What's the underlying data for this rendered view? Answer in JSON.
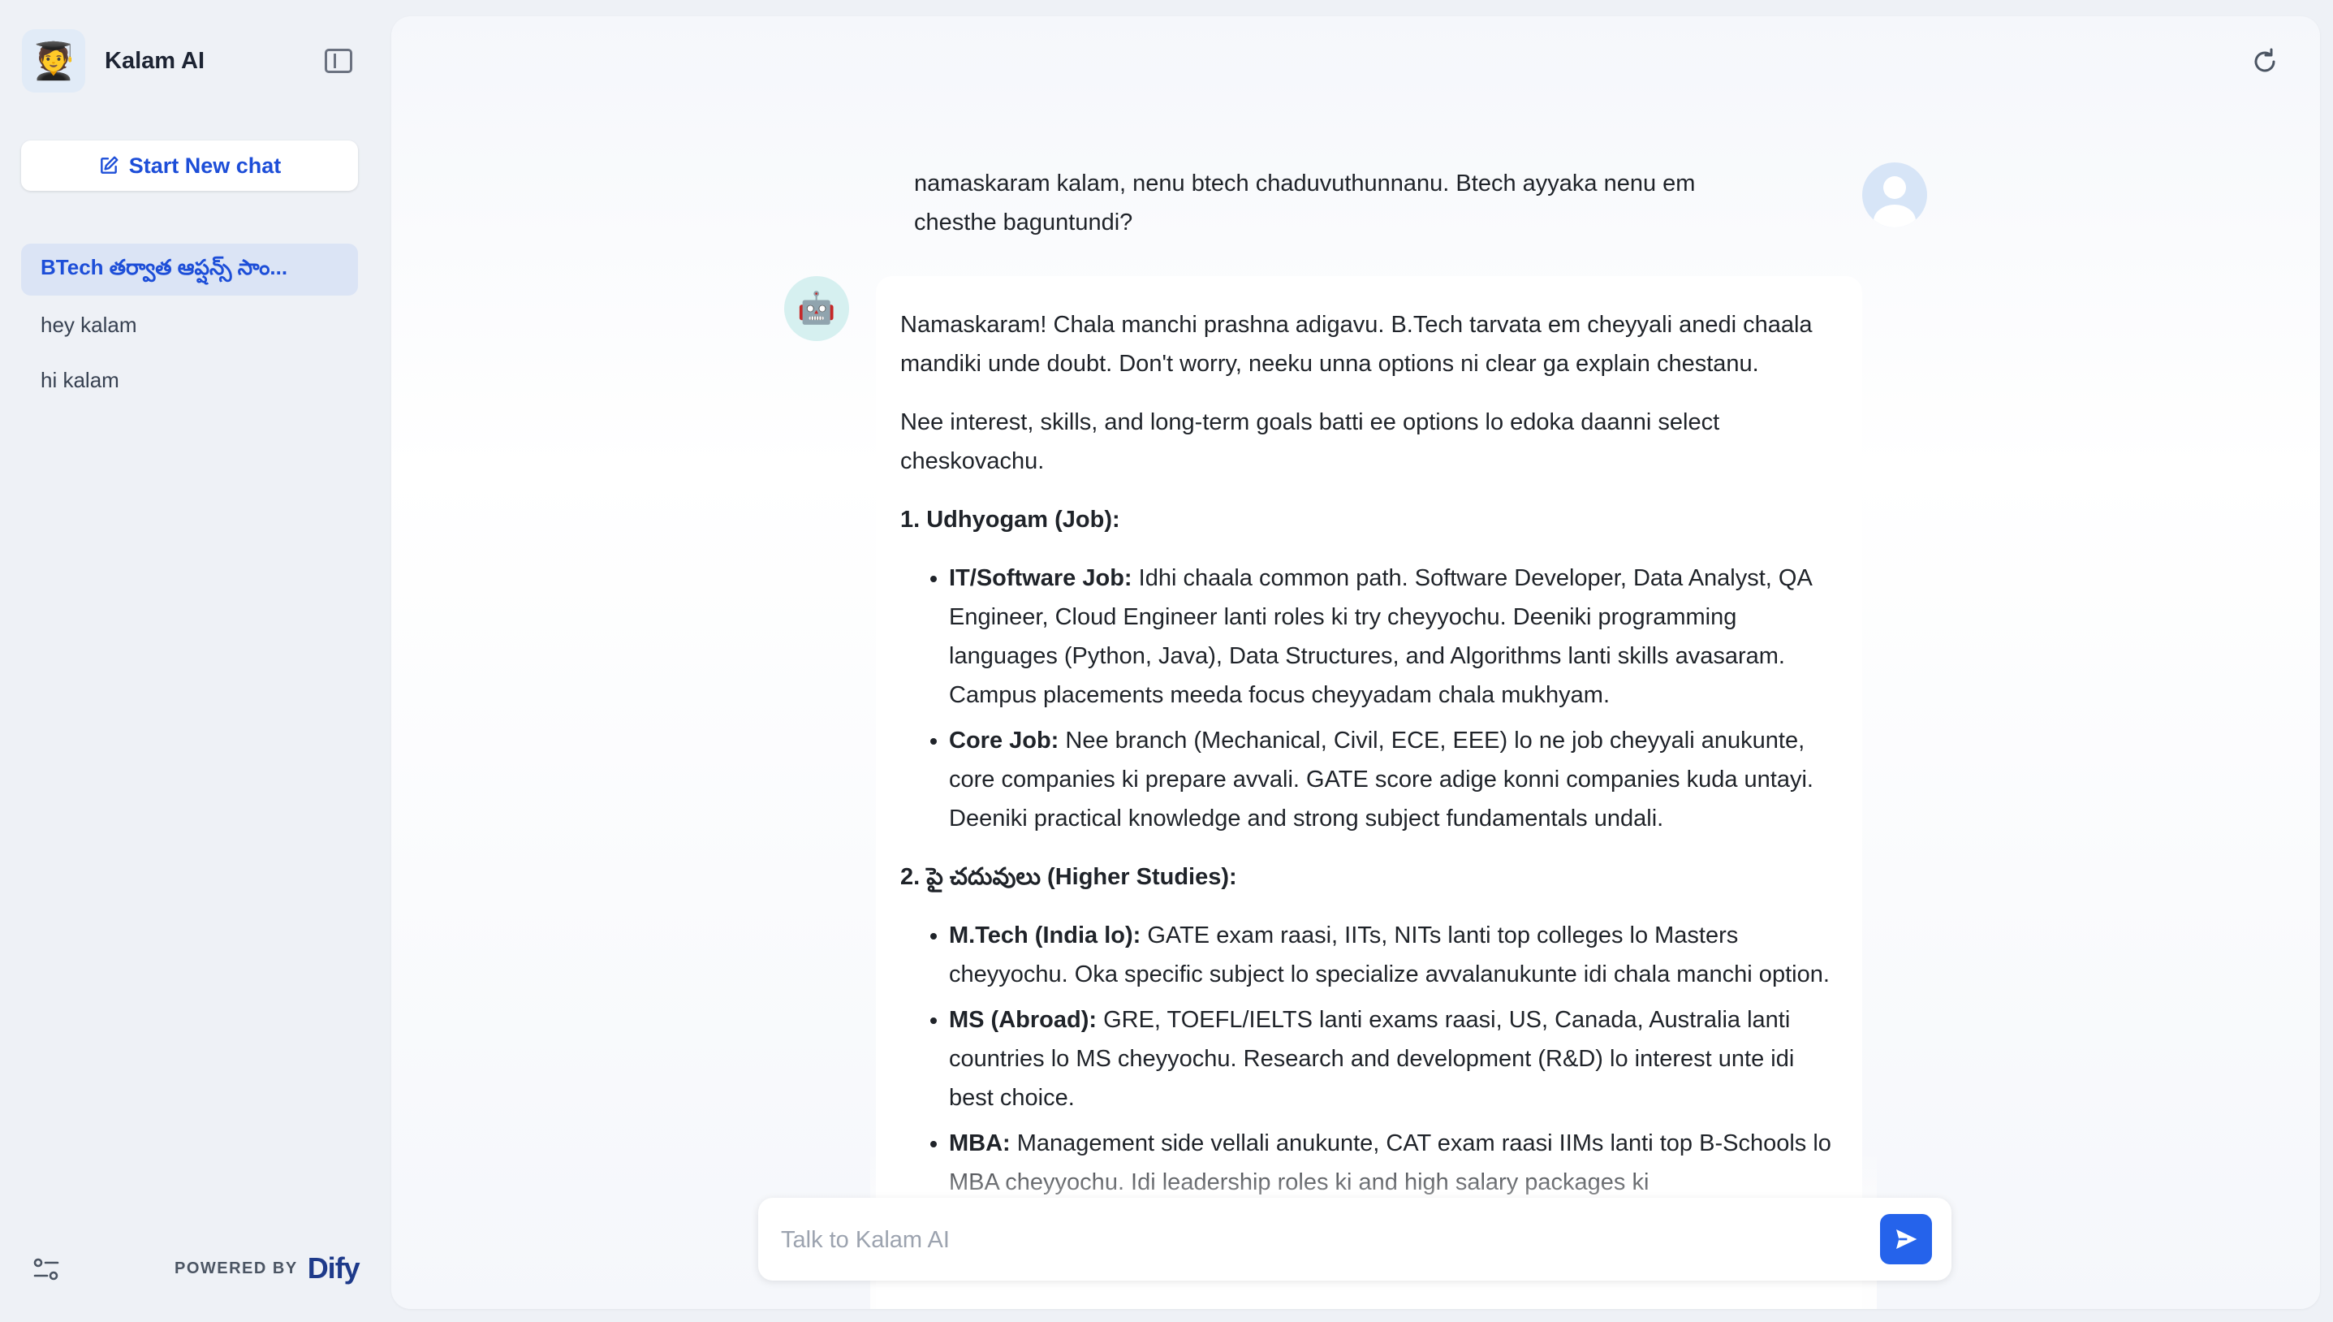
{
  "app": {
    "name": "Kalam AI",
    "logo_emoji": "🧑‍🎓"
  },
  "sidebar": {
    "new_chat_label": "Start New chat",
    "conversations": [
      {
        "label": "BTech తర్వాత ఆప్షన్స్ సాం...",
        "active": true
      },
      {
        "label": "hey kalam",
        "active": false
      },
      {
        "label": "hi kalam",
        "active": false
      }
    ],
    "footer": {
      "powered_by": "POWERED BY",
      "brand": "Dify"
    }
  },
  "chat": {
    "user_message": "namaskaram kalam, nenu btech chaduvuthunnanu. Btech ayyaka nenu em chesthe baguntundi?",
    "bot_avatar_emoji": "🤖",
    "bot_message": {
      "intro": "Namaskaram! Chala manchi prashna adigavu. B.Tech tarvata em cheyyali anedi chaala mandiki unde doubt. Don't worry, neeku unna options ni clear ga explain chestanu.",
      "intro2": "Nee interest, skills, and long-term goals batti ee options lo edoka daanni select cheskovachu.",
      "sections": [
        {
          "heading": "1. Udhyogam (Job):",
          "items": [
            {
              "title": "IT/Software Job:",
              "text": " Idhi chaala common path. Software Developer, Data Analyst, QA Engineer, Cloud Engineer lanti roles ki try cheyyochu. Deeniki programming languages (Python, Java), Data Structures, and Algorithms lanti skills avasaram. Campus placements meeda focus cheyyadam chala mukhyam."
            },
            {
              "title": "Core Job:",
              "text": " Nee branch (Mechanical, Civil, ECE, EEE) lo ne job cheyyali anukunte, core companies ki prepare avvali. GATE score adige konni companies kuda untayi. Deeniki practical knowledge and strong subject fundamentals undali."
            }
          ]
        },
        {
          "heading": "2. పై చదువులు (Higher Studies):",
          "items": [
            {
              "title": "M.Tech (India lo):",
              "text": " GATE exam raasi, IITs, NITs lanti top colleges lo Masters cheyyochu. Oka specific subject lo specialize avvalanukunte idi chala manchi option."
            },
            {
              "title": "MS (Abroad):",
              "text": " GRE, TOEFL/IELTS lanti exams raasi, US, Canada, Australia lanti countries lo MS cheyyochu. Research and development (R&D) lo interest unte idi best choice."
            },
            {
              "title": "MBA:",
              "text": " Management side vellali anukunte, CAT exam raasi IIMs lanti top B-Schools lo MBA cheyyochu. Idi leadership roles ki and high salary packages ki"
            }
          ]
        }
      ]
    }
  },
  "input": {
    "placeholder": "Talk to Kalam AI",
    "value": ""
  },
  "colors": {
    "accent": "#2563eb",
    "active_conversation_bg": "#dbe4f5",
    "sidebar_bg": "#eef1f6"
  }
}
